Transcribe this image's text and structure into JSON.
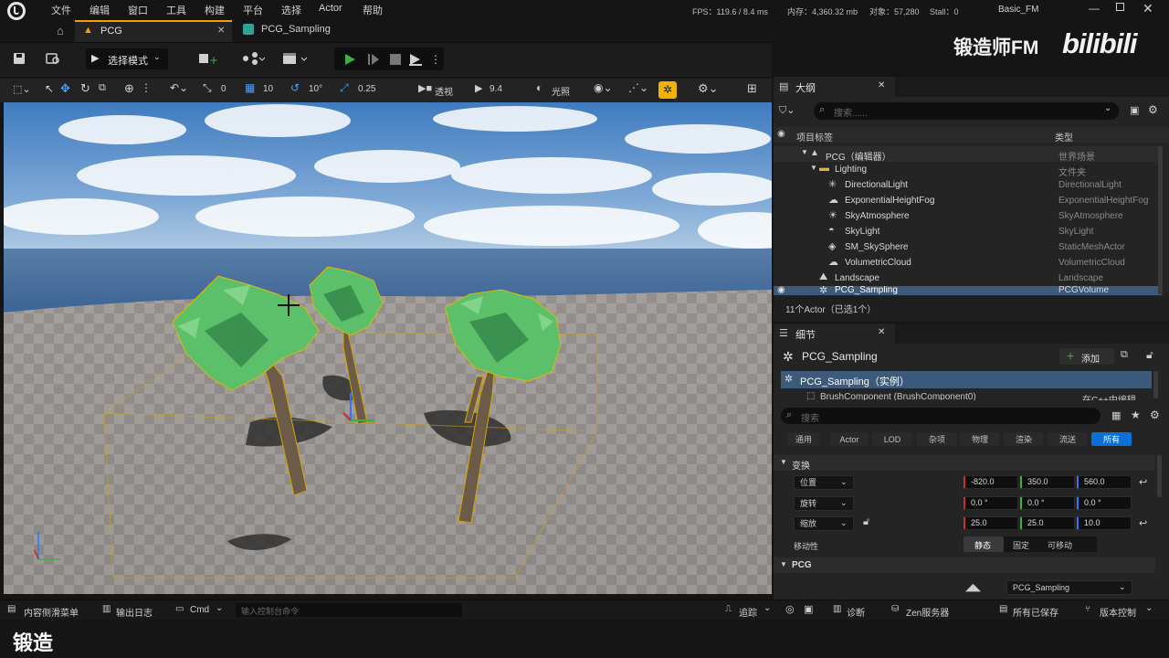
{
  "menu": {
    "items": [
      "文件",
      "编辑",
      "窗口",
      "工具",
      "构建",
      "平台",
      "选择",
      "Actor",
      "帮助"
    ]
  },
  "stats": {
    "fps": "FPS：119.6 / 8.4 ms",
    "memory": "内存：4,360.32 mb",
    "objects": "对象：57,280",
    "stall": "Stall：0",
    "project": "Basic_FM"
  },
  "watermark": {
    "channel": "锻造师FM",
    "site": "bilibili"
  },
  "tabs": [
    {
      "label": "PCG"
    },
    {
      "label": "PCG_Sampling"
    }
  ],
  "toolbar": {
    "mode": "选择模式"
  },
  "viewport_bar": {
    "rot_snap": "0",
    "grid_snap": "10",
    "angle_snap": "10°",
    "scale_snap": "0.25",
    "view": "透视",
    "camera_speed": "9.4",
    "lighting": "光照"
  },
  "outliner": {
    "title": "大纲",
    "search_placeholder": "搜索......",
    "col_label": "项目标签",
    "col_type": "类型",
    "rows": [
      {
        "label": "PCG（编辑器）",
        "type": "世界场景"
      },
      {
        "label": "Lighting",
        "type": "文件夹"
      },
      {
        "label": "DirectionalLight",
        "type": "DirectionalLight"
      },
      {
        "label": "ExponentialHeightFog",
        "type": "ExponentialHeightFog"
      },
      {
        "label": "SkyAtmosphere",
        "type": "SkyAtmosphere"
      },
      {
        "label": "SkyLight",
        "type": "SkyLight"
      },
      {
        "label": "SM_SkySphere",
        "type": "StaticMeshActor"
      },
      {
        "label": "VolumetricCloud",
        "type": "VolumetricCloud"
      },
      {
        "label": "Landscape",
        "type": "Landscape"
      },
      {
        "label": "PCG_Sampling",
        "type": "PCGVolume"
      }
    ],
    "count": "11个Actor（已选1个）"
  },
  "details": {
    "title": "细节",
    "actor_name": "PCG_Sampling",
    "add_label": "添加",
    "instance_label": "PCG_Sampling（实例）",
    "component_label": "BrushComponent (BrushComponent0)",
    "component_note": "在C++中编辑",
    "search_placeholder": "搜索",
    "filters": [
      "通用",
      "Actor",
      "LOD",
      "杂项",
      "物理",
      "渲染",
      "流送",
      "所有"
    ],
    "transform_section": "变换",
    "location_label": "位置",
    "rotation_label": "旋转",
    "scale_label": "缩放",
    "location": [
      "-820.0",
      "350.0",
      "560.0"
    ],
    "rotation": [
      "0.0 °",
      "0.0 °",
      "0.0 °"
    ],
    "scale": [
      "25.0",
      "25.0",
      "10.0"
    ],
    "mobility_label": "移动性",
    "mobility_options": [
      "静态",
      "固定",
      "可移动"
    ],
    "pcg_section": "PCG",
    "pcg_graph": "PCG_Sampling"
  },
  "statusbar": {
    "content_drawer": "内容侧滑菜单",
    "output_log": "输出日志",
    "cmd": "Cmd",
    "cmd_placeholder": "输入控制台命令",
    "trace": "追踪",
    "diagnostics": "诊断",
    "zen": "Zen服务器",
    "saved": "所有已保存",
    "source_control": "版本控制"
  },
  "caption": {
    "text": "锻造"
  },
  "colors": {
    "accent_blue": "#0a6fd8",
    "selection": "#3d5a7a",
    "play_green": "#3cb043",
    "snap_yellow": "#f0b400"
  }
}
